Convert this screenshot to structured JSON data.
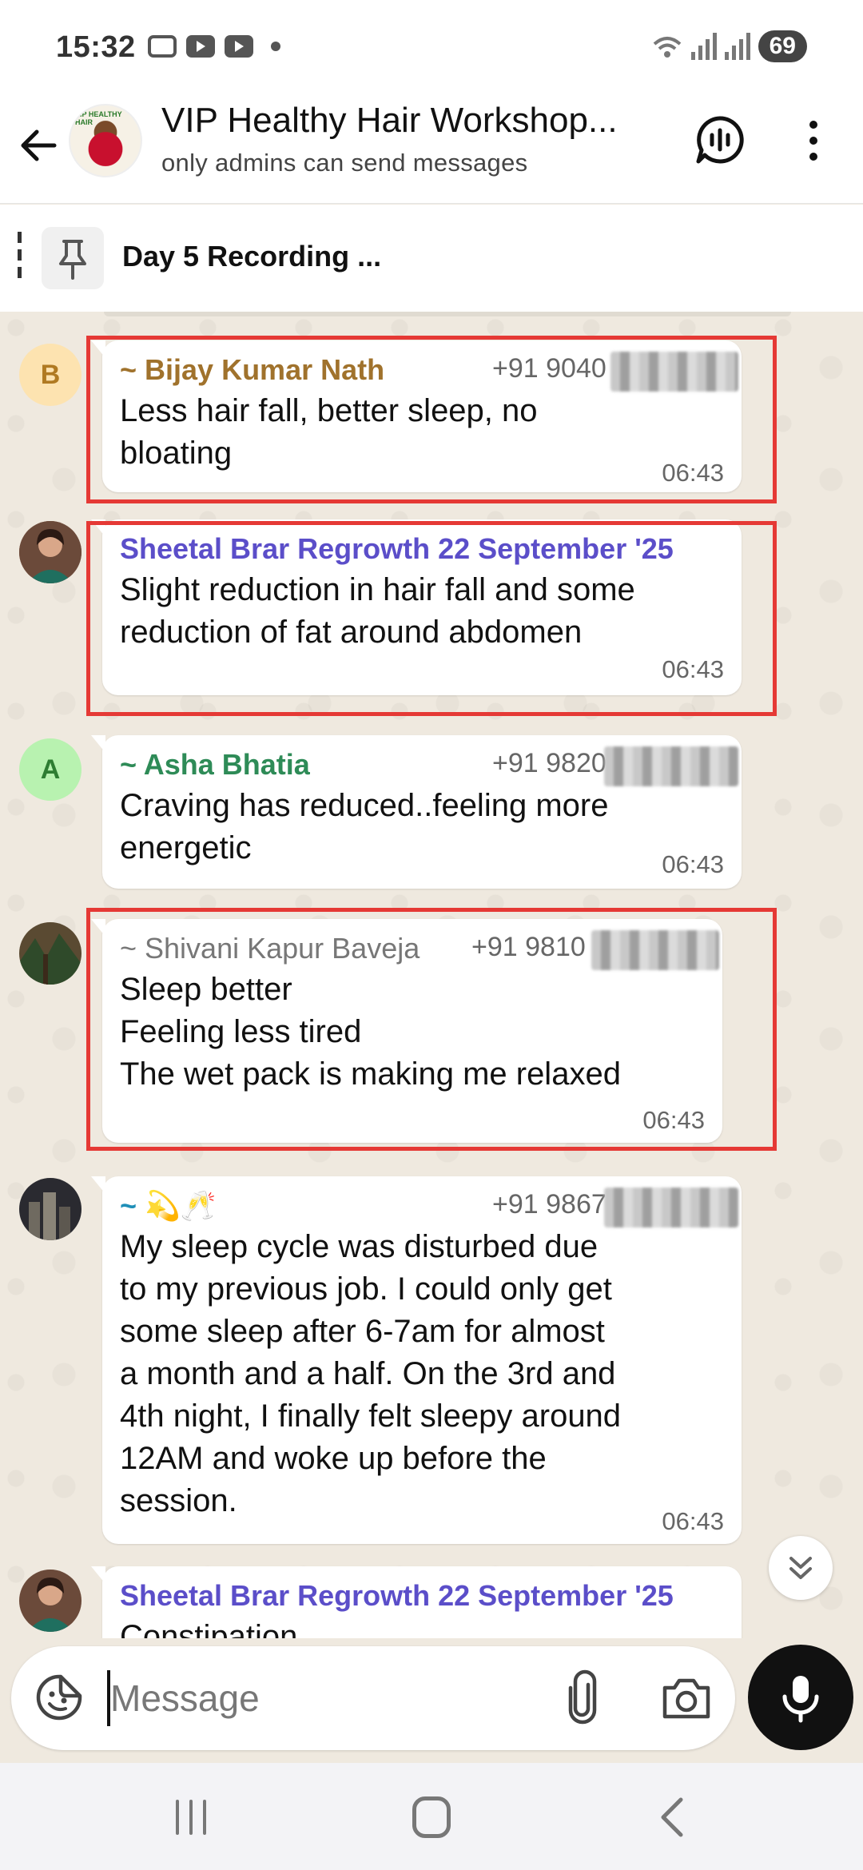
{
  "status_bar": {
    "time": "15:32",
    "battery": "69"
  },
  "header": {
    "title": "VIP Healthy Hair Workshop...",
    "subtitle": "only admins can send messages",
    "avatar_text": "VIP HEALTHY HAIR"
  },
  "pinned": {
    "text": "Day 5 Recording ..."
  },
  "messages": [
    {
      "avatar_letter": "B",
      "sender": "~ Bijay Kumar Nath",
      "phone": "+91 9040",
      "text": "Less hair fall, better sleep, no\nbloating",
      "time": "06:43",
      "sender_color": "#a0722c",
      "highlighted": true
    },
    {
      "sender": "Sheetal Brar Regrowth 22 September '25",
      "text": "Slight reduction in hair fall and some\nreduction of fat around abdomen",
      "time": "06:43",
      "sender_color": "#5b4ec9",
      "highlighted": true
    },
    {
      "avatar_letter": "A",
      "sender": "~ Asha Bhatia",
      "phone": "+91 9820",
      "text": "Craving has reduced..feeling more\nenergetic",
      "time": "06:43",
      "sender_color": "#2e8b57",
      "highlighted": false
    },
    {
      "sender": "~ Shivani Kapur Baveja",
      "phone": "+91 9810",
      "text": "Sleep better\nFeeling less tired\nThe wet pack is making me relaxed",
      "time": "06:43",
      "sender_color": "#777777",
      "highlighted": true
    },
    {
      "sender": "~ 💫🥂",
      "phone": "+91 9867",
      "text": "My sleep cycle was disturbed due\nto my previous job. I could only get\nsome sleep after 6-7am for almost\na month and a half. On the 3rd and\n4th night, I finally felt sleepy around\n12AM and woke up before the\nsession.",
      "time": "06:43",
      "sender_color": "#1f8fb8",
      "highlighted": false
    },
    {
      "sender": "Sheetal Brar Regrowth 22 September '25",
      "text": "Constipation",
      "sender_color": "#5b4ec9",
      "highlighted": false
    }
  ],
  "input": {
    "placeholder": "Message"
  },
  "colors": {
    "highlight": "#e53935",
    "chat_bg": "#efe9df",
    "mic_bg": "#111111"
  },
  "icons": [
    "back-arrow-icon",
    "voice-chat-icon",
    "more-vert-icon",
    "pin-icon",
    "sticker-icon",
    "attach-icon",
    "camera-icon",
    "mic-icon",
    "double-chevron-down-icon"
  ]
}
